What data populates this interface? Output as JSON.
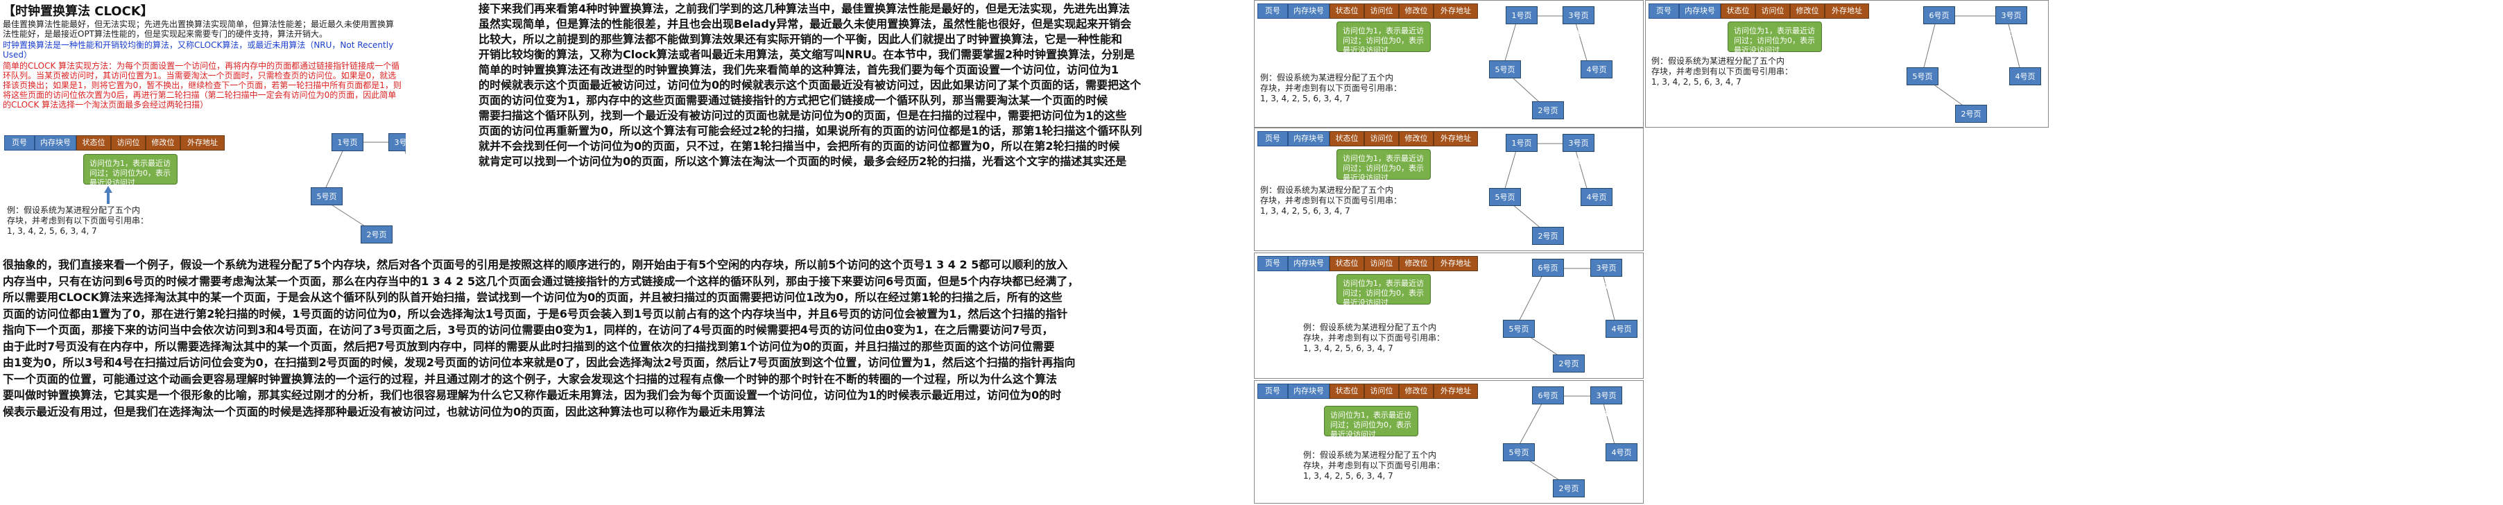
{
  "left": {
    "title": "【时钟置换算法 CLOCK】",
    "intro": "最佳置换算法性能最好，但无法实现；先进先出置换算法实现简单，但算法性能差；最近最久未使用置换算法性能好，是最接近OPT算法性能的，但是实现起来需要专门的硬件支持，算法开销大。",
    "intro2": "时钟置换算法是一种性能和开销较均衡的算法，又称CLOCK算法，或最近未用算法（NRU，Not Recently Used）",
    "desc": "简单的CLOCK 算法实现方法：为每个页面设置一个访问位，再将内存中的页面都通过链接指针链接成一个循环队列。当某页被访问时，其访问位置为1。当需要淘汰一个页面时，只需检查页的访问位。如果是0，就选择该页换出；如果是1，则将它置为0，暂不换出，继续检查下一个页面，若第一轮扫描中所有页面都是1，则将这些页面的访问位依次置为0后，再进行第二轮扫描（第二轮扫描中一定会有访问位为0的页面，因此简单的CLOCK 算法选择一个淘汰页面最多会经过两轮扫描）"
  },
  "table_headers": [
    "页号",
    "内存块号",
    "状态位",
    "访问位",
    "修改位",
    "外存地址"
  ],
  "note_text": "访问位为1，表示最近访问过；访问位为0，表示最近没访问过",
  "example_line1": "例：假设系统为某进程分配了五个内",
  "example_line2": "存块，并考虑到有以下页面号引用串：",
  "example_line3": "1, 3, 4, 2, 5, 6, 3, 4, 7",
  "pages": {
    "p1": "1号页(1)",
    "p3": "3号页(1)",
    "p4": "4号页(1)",
    "p2": "2号页(1)",
    "p5": "5号页(1)",
    "p6": "6号页(1)",
    "p3b": "3号页(0)",
    "p4b": "4号页(0)",
    "p2b": "2号页(0)",
    "p5b": "5号页(0)"
  },
  "para_top": [
    "接下来我们再来看第4种时钟置换算法，之前我们学到的这几种算法当中，最佳置换算法性能是最好的，但是无法实现，先进先出算法",
    "虽然实现简单，但是算法的性能很差，并且也会出现Belady异常，最近最久未使用置换算法，虽然性能也很好，但是实现起来开销会",
    "比较大，所以之前提到的那些算法都不能做到算法效果还有实际开销的一个平衡，因此人们就提出了时钟置换算法，它是一种性能和",
    "开销比较均衡的算法，又称为Clock算法或者叫最近未用算法，英文缩写叫NRU。在本节中，我们需要掌握2种时钟置换算法，分别是",
    "简单的时钟置换算法还有改进型的时钟置换算法，我们先来看简单的这种算法，首先我们要为每个页面设置一个访问位，访问位为1",
    "的时候就表示这个页面最近被访问过，访问位为0的时候就表示这个页面最近没有被访问过，因此如果访问了某个页面的话，需要把这个",
    "页面的访问位变为1，那内存中的这些页面需要通过链接指针的方式把它们链接成一个循环队列，那当需要淘汰某一个页面的时候",
    "需要扫描这个循环队列，找到一个最近没有被访问过的页面也就是访问位为0的页面，但是在扫描的过程中，需要把访问位为1的这些",
    "页面的访问位再重新置为0，所以这个算法有可能会经过2轮的扫描，如果说所有的页面的访问位都是1的话，那第1轮扫描这个循环队列",
    "就并不会找到任何一个访问位为0的页面，只不过，在第1轮扫描当中，会把所有的页面的访问位都置为0，所以在第2轮扫描的时候",
    "就肯定可以找到一个访问位为0的页面，所以这个算法在淘汰一个页面的时候，最多会经历2轮的扫描，光看这个文字的描述其实还是"
  ],
  "para_bottom": [
    "很抽象的，我们直接来看一个例子，假设一个系统为进程分配了5个内存块，然后对各个页面号的引用是按照这样的顺序进行的，刚开始由于有5个空闲的内存块，所以前5个访问的这个页号1 3 4 2 5都可以顺利的放入",
    "内存当中，只有在访问到6号页的时候才需要考虑淘汰某一个页面，那么在内存当中的1 3 4 2 5这几个页面会通过链接指针的方式链接成一个这样的循环队列，那由于接下来要访问6号页面，但是5个内存块都已经满了，",
    "所以需要用CLOCK算法来选择淘汰其中的某一个页面，于是会从这个循环队列的队首开始扫描，尝试找到一个访问位为0的页面，并且被扫描过的页面需要把访问位1改为0，所以在经过第1轮的扫描之后，所有的这些",
    "页面的访问位都由1置为了0，那在进行第2轮扫描的时候，1号页面的访问位为0，所以会选择淘汰1号页面，于是6号页会装入到1号页以前占有的这个内存块当中，并且6号页的访问位会被置为1，然后这个扫描的指针",
    "指向下一个页面，那接下来的访问当中会依次访问到3和4号页面，在访问了3号页面之后，3号页的访问位需要由0变为1，同样的，在访问了4号页面的时候需要把4号页的访问位由0变为1，在之后需要访问7号页，",
    "由于此时7号页没有在内存中，所以需要选择淘汰其中的某一个页面，然后把7号页放到内存中，同样的需要从此时扫描到的这个位置依次的扫描找到第1个访问位为0的页面，并且扫描过的那些页面的这个访问位需要",
    "由1变为0，所以3号和4号在扫描过后访问位会变为0，在扫描到2号页面的时候，发现2号页面的访问位本来就是0了，因此会选择淘汰2号页面，然后让7号页面放到这个位置，访问位置为1，然后这个扫描的指针再指向",
    "下一个页面的位置，可能通过这个动画会更容易理解时钟置换算法的一个运行的过程，并且通过刚才的这个例子，大家会发现这个扫描的过程有点像一个时钟的那个时针在不断的转圈的一个过程，所以为什么这个算法",
    "要叫做时钟置换算法，它其实是一个很形象的比喻，那其实经过刚才的分析，我们也很容易理解为什么它又称作最近未用算法，因为我们会为每个页面设置一个访问位，访问位为1的时候表示最近用过，访问位为0的时",
    "候表示最近没有用过，但是我们在选择淘汰一个页面的时候是选择那种最近没有被访问过，也就访问位为0的页面，因此这种算法也可以称作为最近未用算法"
  ]
}
